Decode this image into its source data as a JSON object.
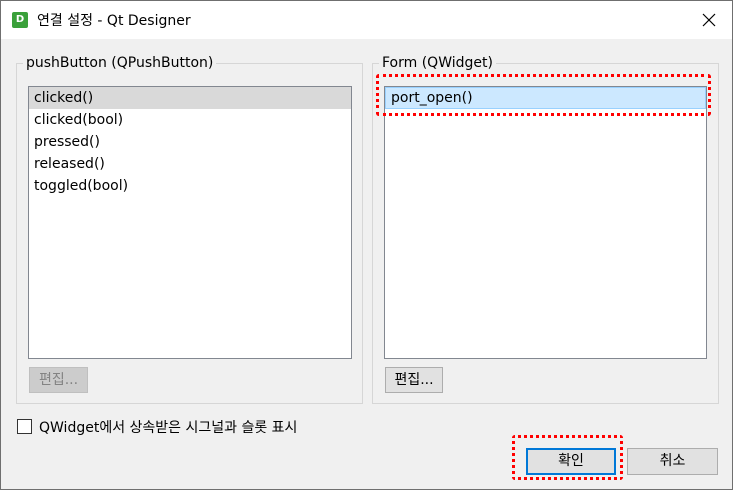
{
  "window": {
    "icon_letter": "D",
    "title": "연결 설정 - Qt Designer"
  },
  "left_group": {
    "title": "pushButton (QPushButton)",
    "items": [
      "clicked()",
      "clicked(bool)",
      "pressed()",
      "released()",
      "toggled(bool)"
    ],
    "selected_index": 0,
    "edit_button": "편집..."
  },
  "right_group": {
    "title": "Form (QWidget)",
    "items": [
      "port_open()"
    ],
    "selected_index": 0,
    "edit_button": "편집..."
  },
  "show_inherited": {
    "label": "QWidget에서 상속받은 시그널과 슬롯 표시",
    "checked": false
  },
  "buttons": {
    "ok": "확인",
    "cancel": "취소"
  },
  "highlight_color": "#ff0000",
  "accent_color": "#0078d7"
}
